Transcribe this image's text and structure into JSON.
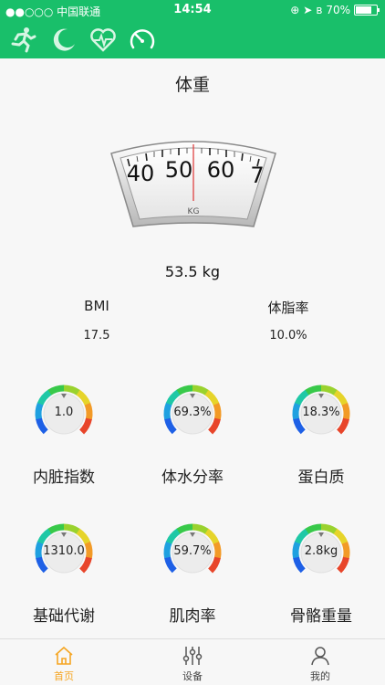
{
  "status_bar": {
    "carrier": "●●○○○ 中国联通",
    "time": "14:54",
    "battery": "70%"
  },
  "nav_icons": [
    "running-icon",
    "moon-icon",
    "heart-rate-icon",
    "gauge-icon"
  ],
  "page": {
    "title": "体重"
  },
  "scale": {
    "ticks": [
      "40",
      "50",
      "60",
      "7"
    ],
    "unit": "KG"
  },
  "weight": "53.5 kg",
  "metrics": [
    {
      "label": "BMI",
      "value": "17.5"
    },
    {
      "label": "体脂率",
      "value": "10.0%"
    }
  ],
  "gauges": [
    {
      "label": "内脏指数",
      "value": "1.0"
    },
    {
      "label": "体水分率",
      "value": "69.3%"
    },
    {
      "label": "蛋白质",
      "value": "18.3%"
    },
    {
      "label": "基础代谢",
      "value": "1310.0"
    },
    {
      "label": "肌肉率",
      "value": "59.7%"
    },
    {
      "label": "骨骼重量",
      "value": "2.8kg"
    }
  ],
  "tabs": [
    {
      "label": "首页",
      "icon": "home-icon",
      "active": true
    },
    {
      "label": "设备",
      "icon": "sliders-icon",
      "active": false
    },
    {
      "label": "我的",
      "icon": "user-icon",
      "active": false
    }
  ],
  "colors": {
    "header": "#19bf6a",
    "active_tab": "#f5a623"
  }
}
